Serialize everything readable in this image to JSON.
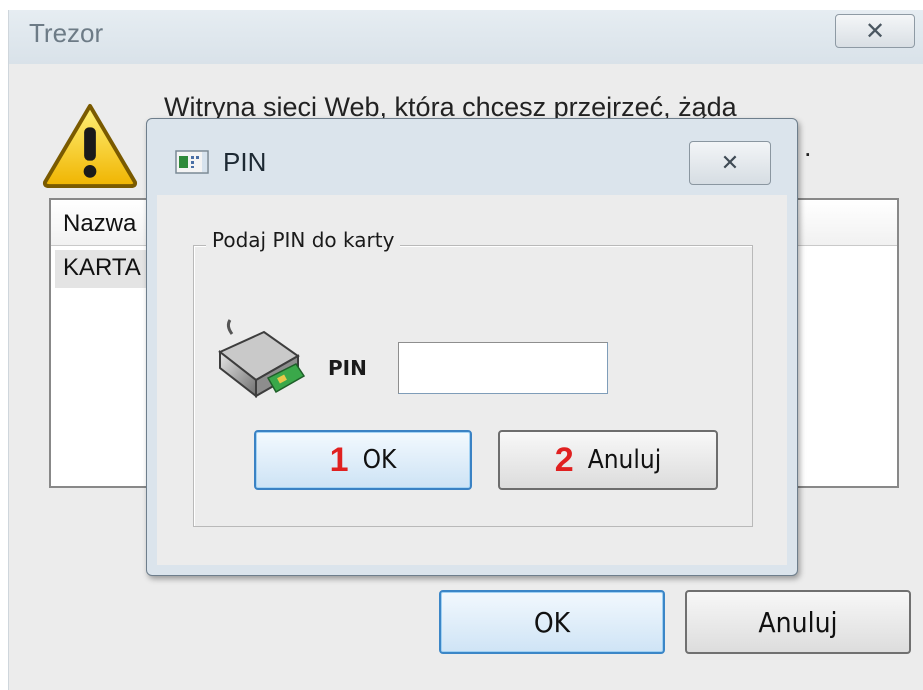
{
  "back_window": {
    "title": "Trezor",
    "close_glyph": "✕",
    "message": "Witryna sieci Web, która chcesz przejrzeć, żąda",
    "message_suffix": ".",
    "list": {
      "column_header": "Nazwa",
      "rows": [
        {
          "label": "KARTA"
        }
      ]
    },
    "ok_label": "OK",
    "cancel_label": "Anuluj",
    "icon": "warning-icon"
  },
  "pin_dialog": {
    "title": "PIN",
    "title_icon": "card-app-icon",
    "close_glyph": "✕",
    "group_label": "Podaj PIN do karty",
    "reader_icon": "smart-card-reader-icon",
    "pin_label": "PIN",
    "pin_value": "",
    "ok_label": "OK",
    "cancel_label": "Anuluj",
    "ok_step": "1",
    "cancel_step": "2"
  },
  "colors": {
    "step_marker": "#e02020",
    "default_button_border": "#3a82c4"
  }
}
